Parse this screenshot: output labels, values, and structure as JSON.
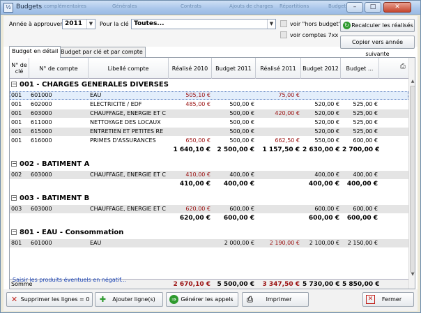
{
  "window": {
    "title": "Budgets"
  },
  "titlebar_ghosts": [
    "complémentaires",
    "Générales",
    "Contrats",
    "Ajouts de charges",
    "Répartitions",
    "Budget"
  ],
  "filters": {
    "annee_label": "Année à approuver",
    "annee_value": "2011",
    "cle_label": "Pour la clé",
    "cle_value": "Toutes...",
    "hors_budget_label": "voir \"hors budget\"",
    "comptes_label": "voir comptes 7xx"
  },
  "buttons": {
    "recalculer": "Recalculer les réalisés",
    "copier": "Copier vers année suivante"
  },
  "tabs": [
    {
      "label": "Budget en détail"
    },
    {
      "label": "Budget par clé et par compte"
    }
  ],
  "columns": [
    "N° de clé",
    "N° de compte",
    "Libellé compte",
    "Réalisé 2010",
    "Budget 2011",
    "Réalisé 2011",
    "Budget 2012",
    "Budget ..."
  ],
  "groups": [
    {
      "title": "001 - CHARGES GENERALES DIVERSES",
      "rows": [
        {
          "cle": "001",
          "compte": "601000",
          "libelle": "EAU",
          "r2010": "505,10 €",
          "b2011": "",
          "r2011": "75,00 €",
          "b2012": "",
          "bnext": ""
        },
        {
          "cle": "001",
          "compte": "602000",
          "libelle": "ELECTRICITE / EDF",
          "r2010": "485,00 €",
          "b2011": "500,00 €",
          "r2011": "",
          "b2012": "520,00 €",
          "bnext": "525,00 €"
        },
        {
          "cle": "001",
          "compte": "603000",
          "libelle": "CHAUFFAGE, ENERGIE ET C",
          "r2010": "",
          "b2011": "500,00 €",
          "r2011": "420,00 €",
          "b2012": "520,00 €",
          "bnext": "525,00 €"
        },
        {
          "cle": "001",
          "compte": "611000",
          "libelle": "NETTOYAGE DES LOCAUX",
          "r2010": "",
          "b2011": "500,00 €",
          "r2011": "",
          "b2012": "520,00 €",
          "bnext": "525,00 €"
        },
        {
          "cle": "001",
          "compte": "615000",
          "libelle": "ENTRETIEN ET PETITES RE",
          "r2010": "",
          "b2011": "500,00 €",
          "r2011": "",
          "b2012": "520,00 €",
          "bnext": "525,00 €"
        },
        {
          "cle": "001",
          "compte": "616000",
          "libelle": "PRIMES D'ASSURANCES",
          "r2010": "650,00 €",
          "b2011": "500,00 €",
          "r2011": "662,50 €",
          "b2012": "550,00 €",
          "bnext": "600,00 €"
        }
      ],
      "totals": {
        "r2010": "1 640,10 €",
        "b2011": "2 500,00 €",
        "r2011": "1 157,50 €",
        "b2012": "2 630,00 €",
        "bnext": "2 700,00 €"
      }
    },
    {
      "title": "002 - BATIMENT A",
      "rows": [
        {
          "cle": "002",
          "compte": "603000",
          "libelle": "CHAUFFAGE, ENERGIE ET C",
          "r2010": "410,00 €",
          "b2011": "400,00 €",
          "r2011": "",
          "b2012": "400,00 €",
          "bnext": "400,00 €"
        }
      ],
      "totals": {
        "r2010": "410,00 €",
        "b2011": "400,00 €",
        "r2011": "",
        "b2012": "400,00 €",
        "bnext": "400,00 €"
      }
    },
    {
      "title": "003 - BATIMENT B",
      "rows": [
        {
          "cle": "003",
          "compte": "603000",
          "libelle": "CHAUFFAGE, ENERGIE ET C",
          "r2010": "620,00 €",
          "b2011": "600,00 €",
          "r2011": "",
          "b2012": "600,00 €",
          "bnext": "600,00 €"
        }
      ],
      "totals": {
        "r2010": "620,00 €",
        "b2011": "600,00 €",
        "r2011": "",
        "b2012": "600,00 €",
        "bnext": "600,00 €"
      }
    },
    {
      "title": "801 - EAU - Consommation",
      "rows": [
        {
          "cle": "801",
          "compte": "601000",
          "libelle": "EAU",
          "r2010": "",
          "b2011": "2 000,00 €",
          "r2011": "2 190,00 €",
          "b2012": "2 100,00 €",
          "bnext": "2 150,00 €"
        }
      ],
      "totals": null
    }
  ],
  "somme": {
    "label": "Somme",
    "r2010": "2 670,10 €",
    "b2011": "5 500,00 €",
    "r2011": "3 347,50 €",
    "b2012": "5 730,00 €",
    "bnext": "5 850,00 €"
  },
  "link_text": "Saisir les produits éventuels en négatif...",
  "bottom_buttons": {
    "supprimer": "Supprimer les lignes = 0",
    "ajouter": "Ajouter ligne(s)",
    "generer": "Générer les appels",
    "imprimer": "Imprimer",
    "fermer": "Fermer"
  },
  "colors": {
    "red_value": "#9a1010",
    "link": "#1c46b8",
    "green": "#2e9a2e"
  }
}
